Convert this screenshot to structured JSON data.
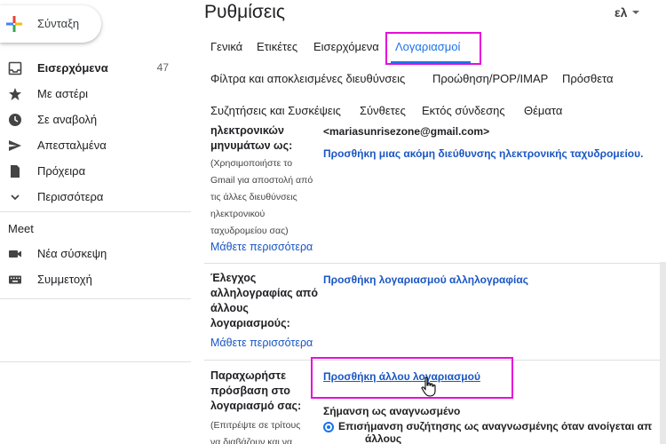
{
  "compose": {
    "label": "Σύνταξη"
  },
  "sidebar": {
    "items": [
      {
        "label": "Εισερχόμενα",
        "count": "47",
        "icon": "inbox-icon"
      },
      {
        "label": "Με αστέρι",
        "icon": "star-icon"
      },
      {
        "label": "Σε αναβολή",
        "icon": "clock-icon"
      },
      {
        "label": "Απεσταλμένα",
        "icon": "send-icon"
      },
      {
        "label": "Πρόχειρα",
        "icon": "draft-icon"
      },
      {
        "label": "Περισσότερα",
        "icon": "chevron-down-icon"
      }
    ],
    "meet_title": "Meet",
    "meet_items": [
      {
        "label": "Νέα σύσκεψη",
        "icon": "videocam-icon"
      },
      {
        "label": "Συμμετοχή",
        "icon": "keyboard-icon"
      }
    ]
  },
  "header": {
    "title": "Ρυθμίσεις",
    "language": "ελ"
  },
  "tabs": {
    "row1": [
      "Γενικά",
      "Ετικέτες",
      "Εισερχόμενα",
      "Λογαριασμοί"
    ],
    "row2": [
      "Φίλτρα και αποκλεισμένες διευθύνσεις",
      "Προώθηση/POP/IMAP",
      "Πρόσθετα"
    ],
    "row3": [
      "Συζητήσεις και Συσκέψεις",
      "Σύνθετες",
      "Εκτός σύνδεσης",
      "Θέματα"
    ]
  },
  "sections": {
    "send_as": {
      "label_lines": [
        "ηλεκτρονικών",
        "μηνυμάτων ως:"
      ],
      "note_lines": [
        "(Χρησιμοποιήστε το",
        "Gmail για αποστολή από",
        "τις άλλες διευθύνσεις",
        "ηλεκτρονικού",
        "ταχυδρομείου σας)"
      ],
      "more": "Μάθετε περισσότερα",
      "email": "<mariasunrisezone@gmail.com>",
      "add_link": "Προσθήκη μιας ακόμη διεύθυνσης ηλεκτρονικής ταχυδρομείου."
    },
    "check_mail": {
      "label_lines": [
        "Έλεγχος",
        "αλληλογραφίας από",
        "άλλους",
        "λογαριασμούς:"
      ],
      "more": "Μάθετε περισσότερα",
      "add_link": "Προσθήκη λογαριασμού αλληλογραφίας"
    },
    "grant_access": {
      "label_lines": [
        "Παραχωρήστε",
        "πρόσβαση στο",
        "λογαριασμό σας:"
      ],
      "note_lines": [
        "(Επιτρέψτε σε τρίτους",
        "να διαβάζουν και να"
      ],
      "add_link": "Προσθήκη άλλου λογαριασμού",
      "mark_read_title": "Σήμανση ως αναγνωσμένο",
      "radio_label_lines": [
        "Επισήμανση συζήτησης ως αναγνωσμένης όταν ανοίγεται απ",
        "άλλους"
      ]
    }
  },
  "colors": {
    "accent": "#1a73e8",
    "link": "#1a56c4",
    "highlight": "#e60fd9"
  }
}
